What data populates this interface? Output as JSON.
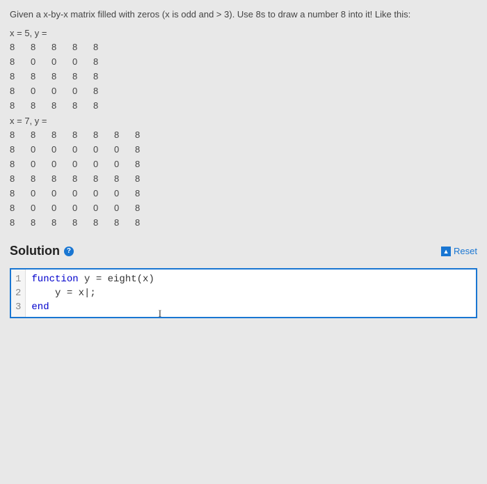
{
  "problem": {
    "description": "Given a x-by-x matrix filled with zeros (x is odd and > 3). Use 8s to draw a number 8 into it! Like this:",
    "example1": {
      "label": "x = 5, y =",
      "rows": [
        [
          "8",
          "8",
          "8",
          "8",
          "8"
        ],
        [
          "8",
          "0",
          "0",
          "0",
          "8"
        ],
        [
          "8",
          "8",
          "8",
          "8",
          "8"
        ],
        [
          "8",
          "0",
          "0",
          "0",
          "8"
        ],
        [
          "8",
          "8",
          "8",
          "8",
          "8"
        ]
      ]
    },
    "example2": {
      "label": "x = 7, y =",
      "rows": [
        [
          "8",
          "8",
          "8",
          "8",
          "8",
          "8",
          "8"
        ],
        [
          "8",
          "0",
          "0",
          "0",
          "0",
          "0",
          "8"
        ],
        [
          "8",
          "0",
          "0",
          "0",
          "0",
          "0",
          "8"
        ],
        [
          "8",
          "8",
          "8",
          "8",
          "8",
          "8",
          "8"
        ],
        [
          "8",
          "0",
          "0",
          "0",
          "0",
          "0",
          "8"
        ],
        [
          "8",
          "0",
          "0",
          "0",
          "0",
          "0",
          "8"
        ],
        [
          "8",
          "8",
          "8",
          "8",
          "8",
          "8",
          "8"
        ]
      ]
    }
  },
  "solution": {
    "title": "Solution",
    "help_symbol": "?",
    "reset_label": "Reset",
    "reset_symbol": "▲",
    "code": {
      "lines": [
        {
          "n": "1",
          "prefix_kw": "function",
          "rest": " y = eight(x)"
        },
        {
          "n": "2",
          "prefix_kw": "",
          "rest": "    y = x|;"
        },
        {
          "n": "3",
          "prefix_kw": "end",
          "rest": ""
        }
      ]
    },
    "cursor_glyph": "I"
  }
}
